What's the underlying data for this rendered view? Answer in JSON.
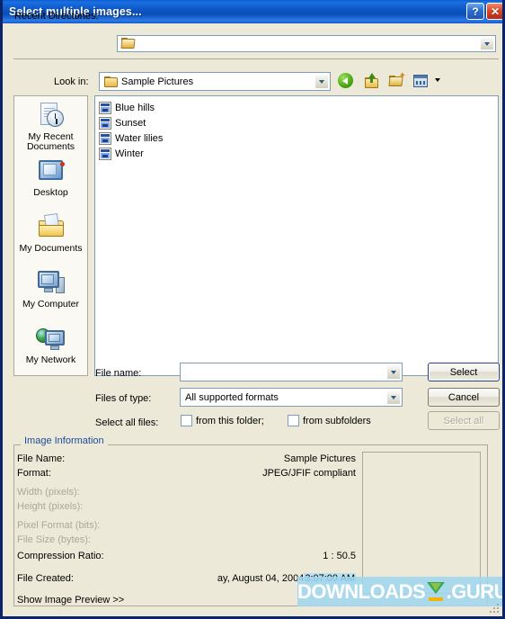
{
  "window": {
    "title": "Select multiple images...",
    "help_button": "?",
    "close_button": "✕"
  },
  "recent": {
    "label": "Recent Directories:",
    "value": "",
    "icon": "open-folder-icon"
  },
  "lookin": {
    "label": "Look in:",
    "value": "Sample Pictures",
    "icon": "folder-icon",
    "toolbar": [
      {
        "name": "back-icon",
        "tooltip": "Back"
      },
      {
        "name": "up-folder-icon",
        "tooltip": "Up One Level"
      },
      {
        "name": "new-folder-icon",
        "tooltip": "Create New Folder"
      },
      {
        "name": "views-icon",
        "tooltip": "Views"
      }
    ]
  },
  "places": [
    {
      "label": "My Recent\nDocuments",
      "icon": "recent-documents-icon"
    },
    {
      "label": "Desktop",
      "icon": "desktop-icon"
    },
    {
      "label": "My Documents",
      "icon": "my-documents-icon"
    },
    {
      "label": "My Computer",
      "icon": "my-computer-icon"
    },
    {
      "label": "My Network",
      "icon": "my-network-icon"
    }
  ],
  "files": [
    {
      "name": "Blue hills",
      "icon": "image-file-icon"
    },
    {
      "name": "Sunset",
      "icon": "image-file-icon"
    },
    {
      "name": "Water lilies",
      "icon": "image-file-icon"
    },
    {
      "name": "Winter",
      "icon": "image-file-icon"
    }
  ],
  "form": {
    "filename_label": "File name:",
    "filename_value": "",
    "filetype_label": "Files of type:",
    "filetype_value": "All supported formats",
    "selectall_label": "Select all files:",
    "checkbox_folder": "from this folder;",
    "checkbox_subfolders": "from subfolders",
    "checkbox_folder_checked": false,
    "checkbox_subfolders_checked": false
  },
  "buttons": {
    "select": "Select",
    "cancel": "Cancel",
    "select_all": "Select all",
    "select_all_disabled": true
  },
  "image_info": {
    "group_title": "Image Information",
    "rows": [
      {
        "label": "File Name:",
        "value": "Sample Pictures",
        "dim": false
      },
      {
        "label": "Format:",
        "value": "JPEG/JFIF compliant",
        "dim": false
      },
      {
        "label": "Width (pixels):",
        "value": "",
        "dim": true
      },
      {
        "label": "Height (pixels):",
        "value": "",
        "dim": true
      },
      {
        "label": "Pixel Format (bits):",
        "value": "",
        "dim": true
      },
      {
        "label": "File Size (bytes):",
        "value": "",
        "dim": true
      },
      {
        "label": "Compression Ratio:",
        "value": "1 : 50.5",
        "dim": false
      },
      {
        "label": "File Created:",
        "value": "ay, August 04, 2004",
        "dim": false
      }
    ],
    "file_created_time": "3:07:00 AM",
    "show_preview": "Show Image Preview   >>"
  },
  "watermark": {
    "text_left": "DOWNLOADS",
    "text_right": ".GURU",
    "logo": "download-arrow-icon"
  },
  "colors": {
    "title_blue": "#0A5BD3",
    "dialog_face": "#ECE9D8",
    "group_title_blue": "#1B4A9C",
    "disabled_gray": "#ACA899",
    "highlight": "#BCE0F0"
  }
}
